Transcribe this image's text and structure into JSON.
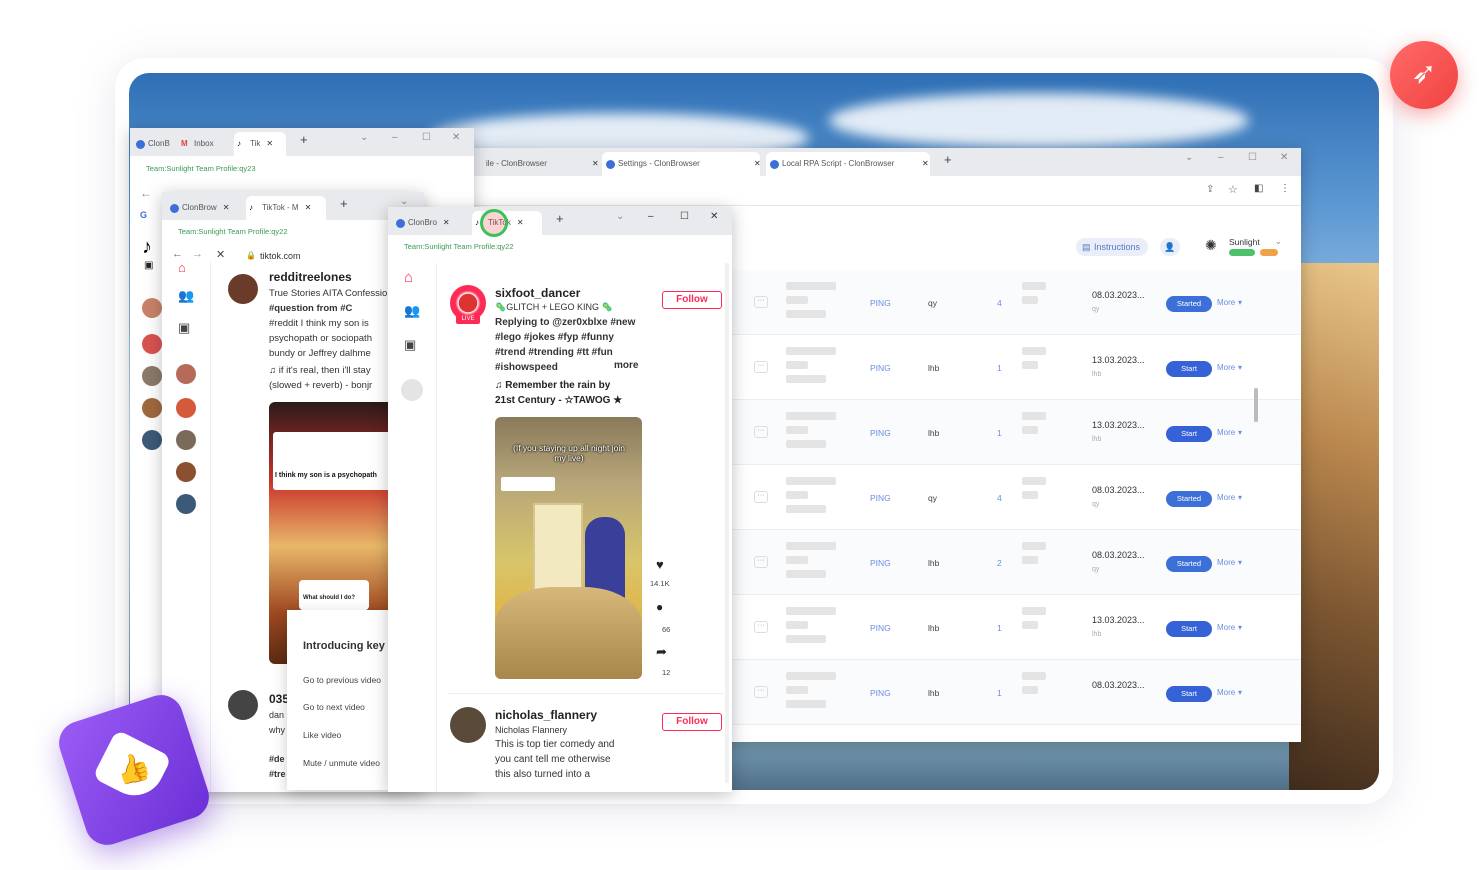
{
  "table_window": {
    "tabs": [
      {
        "label": "ile - ClonBrowser"
      },
      {
        "label": "Settings - ClonBrowser"
      },
      {
        "label": "Local RPA Script - ClonBrowser"
      }
    ],
    "instructions_label": "Instructions",
    "workspace_name": "Sunlight",
    "rows": [
      {
        "platform": "PING",
        "group": "qy",
        "count": "4",
        "date": "08.03.2023...",
        "sub": "qy",
        "status": "Started",
        "more": "More"
      },
      {
        "platform": "PING",
        "group": "lhb",
        "count": "1",
        "date": "13.03.2023...",
        "sub": "lhb",
        "status": "Start",
        "more": "More"
      },
      {
        "platform": "PING",
        "group": "lhb",
        "count": "1",
        "date": "13.03.2023...",
        "sub": "lhb",
        "status": "Start",
        "more": "More"
      },
      {
        "platform": "PING",
        "group": "qy",
        "count": "4",
        "date": "08.03.2023...",
        "sub": "qy",
        "status": "Started",
        "more": "More"
      },
      {
        "platform": "PING",
        "group": "lhb",
        "count": "2",
        "date": "08.03.2023...",
        "sub": "qy",
        "status": "Started",
        "more": "More"
      },
      {
        "platform": "PING",
        "group": "lhb",
        "count": "1",
        "date": "13.03.2023...",
        "sub": "lhb",
        "status": "Start",
        "more": "More"
      },
      {
        "platform": "PING",
        "group": "lhb",
        "count": "1",
        "date": "08.03.2023...",
        "sub": "",
        "status": "Start",
        "more": "More"
      }
    ]
  },
  "window_a": {
    "tabs": [
      "ClonB",
      "Inbox",
      "Tik"
    ],
    "profile": "Team:Sunlight  Team Profile:qy23"
  },
  "window_b": {
    "tabs": [
      "ClonBrow",
      "TikTok - M"
    ],
    "profile": "Team:Sunlight  Team Profile:qy22",
    "url": "tiktok.com",
    "post": {
      "username": "redditreelones",
      "lines": [
        "True Stories AITA Confessio",
        "#question from  #C",
        "#reddit I think my son is",
        "psychopath or sociopath",
        "bundy or Jeffrey dalhme",
        "♫ if it's real, then i'll stay",
        "(slowed + reverb) - bonjr"
      ],
      "video_caption": "I think my son is a psychopath",
      "video_question": "What should I do?"
    },
    "next_username": "035",
    "next_lines": [
      "dan",
      "why",
      "#de",
      "#tre"
    ]
  },
  "popup_menu": {
    "title": "Introducing key",
    "items": [
      "Go to previous video",
      "Go to next video",
      "Like video",
      "Mute / unmute video"
    ]
  },
  "window_c": {
    "tabs": [
      "ClonBro",
      "TikTok"
    ],
    "profile": "Team:Sunlight  Team Profile:qy22",
    "post1": {
      "username": "sixfoot_dancer",
      "subtitle": "🦠GLITCH + LEGO KING 🦠",
      "follow": "Follow",
      "lines": [
        "Replying to @zer0xblxe #new",
        "#lego #jokes #fyp #funny",
        "#trend #trending #tt #fun",
        "#ishowspeed"
      ],
      "more": "more",
      "music": "♫ Remember the rain by",
      "music2": "21st Century - ☆TAWOG ★",
      "live": "LIVE",
      "video_text": "(If you staying up all night join my live)",
      "likes": "14.1K",
      "comments": "66",
      "shares": "12"
    },
    "post2": {
      "username": "nicholas_flannery",
      "display": "Nicholas Flannery",
      "follow": "Follow",
      "lines": [
        "This is top tier comedy and",
        "you cant tell me otherwise",
        "this also turned into a"
      ]
    }
  },
  "colors": {
    "accent": "#3d6fd9",
    "tiktok": "#fe2c55",
    "rocket": "#f0433f",
    "badge": "#7b3ee6"
  }
}
